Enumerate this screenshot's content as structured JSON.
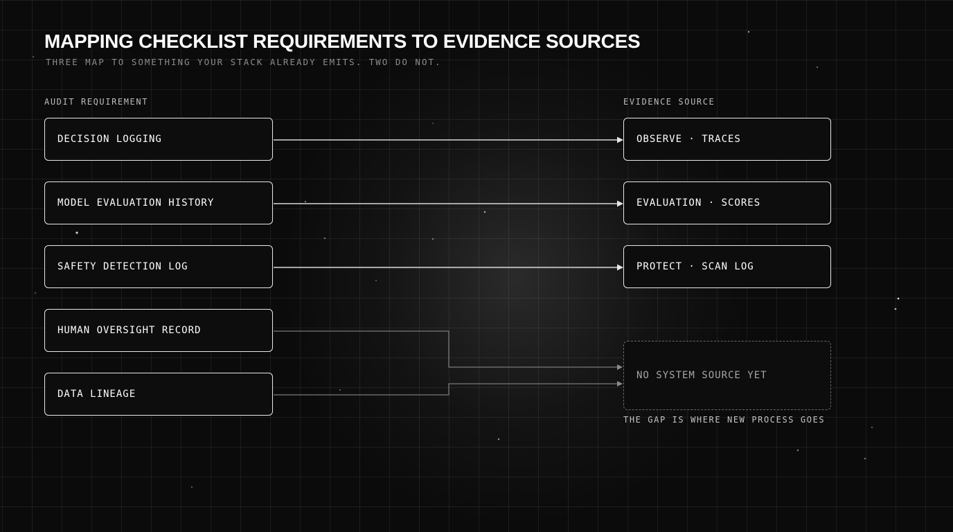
{
  "header": {
    "title": "MAPPING CHECKLIST REQUIREMENTS TO EVIDENCE SOURCES",
    "subtitle": "THREE MAP TO SOMETHING YOUR STACK ALREADY EMITS. TWO DO NOT."
  },
  "columns": {
    "left_heading": "AUDIT REQUIREMENT",
    "right_heading": "EVIDENCE SOURCE"
  },
  "requirements": [
    {
      "label": "DECISION LOGGING"
    },
    {
      "label": "MODEL EVALUATION HISTORY"
    },
    {
      "label": "SAFETY DETECTION LOG"
    },
    {
      "label": "HUMAN OVERSIGHT RECORD"
    },
    {
      "label": "DATA LINEAGE"
    }
  ],
  "sources": [
    {
      "label": "OBSERVE · TRACES"
    },
    {
      "label": "EVALUATION · SCORES"
    },
    {
      "label": "PROTECT · SCAN LOG"
    }
  ],
  "gap": {
    "label": "NO SYSTEM SOURCE YET",
    "note": "THE GAP IS WHERE NEW PROCESS GOES"
  },
  "mappings": [
    {
      "from": "DECISION LOGGING",
      "to": "OBSERVE · TRACES",
      "status": "mapped"
    },
    {
      "from": "MODEL EVALUATION HISTORY",
      "to": "EVALUATION · SCORES",
      "status": "mapped"
    },
    {
      "from": "SAFETY DETECTION LOG",
      "to": "PROTECT · SCAN LOG",
      "status": "mapped"
    },
    {
      "from": "HUMAN OVERSIGHT RECORD",
      "to": "NO SYSTEM SOURCE YET",
      "status": "gap"
    },
    {
      "from": "DATA LINEAGE",
      "to": "NO SYSTEM SOURCE YET",
      "status": "gap"
    }
  ],
  "colors": {
    "background": "#0b0b0b",
    "box_border": "#e9e9e9",
    "mapped_connector": "#d8d8d8",
    "gap_connector": "#7a7a7a",
    "gap_border": "#6a6a6a"
  }
}
